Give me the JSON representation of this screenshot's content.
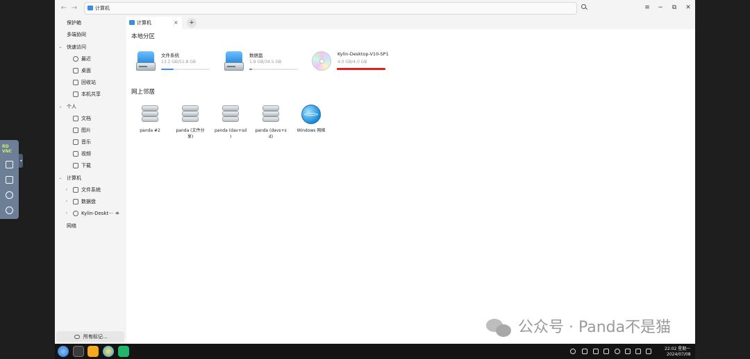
{
  "topbar": {
    "back_glyph": "←",
    "forward_glyph": "→",
    "address": "计算机",
    "menu_glyph": "≡",
    "minimize_glyph": "−",
    "restore_glyph": "⧉",
    "close_glyph": "✕"
  },
  "sidebar": {
    "items": [
      {
        "label": "保护箱"
      },
      {
        "label": "多端协同"
      },
      {
        "label": "快速访问"
      },
      {
        "label": "最近"
      },
      {
        "label": "桌面"
      },
      {
        "label": "回收站"
      },
      {
        "label": "本机共享"
      },
      {
        "label": "个人"
      },
      {
        "label": "文档"
      },
      {
        "label": "图片"
      },
      {
        "label": "音乐"
      },
      {
        "label": "视频"
      },
      {
        "label": "下载"
      },
      {
        "label": "计算机"
      },
      {
        "label": "文件系统"
      },
      {
        "label": "数据盘"
      },
      {
        "label": "Kylin-Deskt···"
      },
      {
        "label": "网络"
      }
    ],
    "footer_label": "所有标记..."
  },
  "tabs": {
    "active_label": "计算机",
    "close_glyph": "×",
    "add_glyph": "+"
  },
  "local": {
    "title": "本地分区",
    "drives": [
      {
        "name": "文件系统",
        "size": "13.2 GB/51.8 GB",
        "used": 0.255,
        "color": "#3a8ee6",
        "icon": "hard-drive-icon"
      },
      {
        "name": "数据盘",
        "size": "1.9 GB/34.5 GB",
        "used": 0.055,
        "color": "#3a8ee6",
        "icon": "hard-drive-icon"
      },
      {
        "name": "Kylin-Desktop-V10-SP1",
        "size": "4.0 GB/4.0 GB",
        "used": 1.0,
        "color": "#e02020",
        "icon": "optical-disc-icon"
      }
    ]
  },
  "network": {
    "title": "网上邻居",
    "items": [
      {
        "label": "panda #2",
        "icon": "server-icon"
      },
      {
        "label": "panda (文件分\n享)",
        "icon": "server-icon"
      },
      {
        "label": "panda (dav+sd\n)",
        "icon": "server-icon"
      },
      {
        "label": "panda (davs+s\nd)",
        "icon": "server-icon"
      },
      {
        "label": "Windows 网络",
        "icon": "globe-icon"
      }
    ]
  },
  "taskbar": {
    "time": "22:02 星期一",
    "date": "2024/07/08"
  },
  "vnc": {
    "logo_top": "RD",
    "logo_bottom": "VNC"
  },
  "watermark": {
    "text": "公众号 · Panda不是猫"
  }
}
